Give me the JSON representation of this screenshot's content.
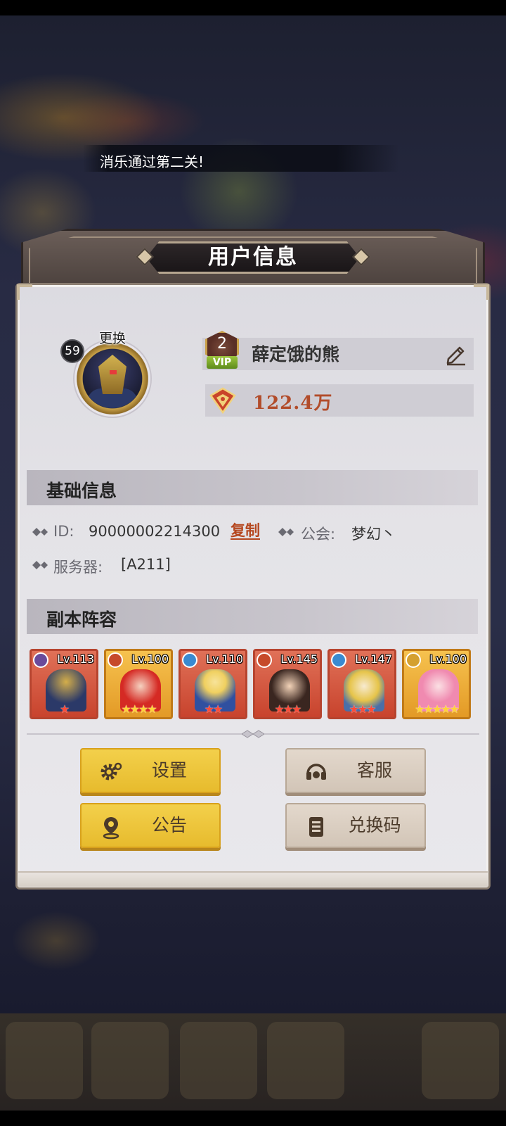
{
  "toast": {
    "message": "消乐通过第二关!"
  },
  "dialog": {
    "title": "用户信息"
  },
  "profile": {
    "level": "59",
    "change_avatar": "更换",
    "vip_level": "2",
    "vip_label": "VIP",
    "name": "薛定饿的熊",
    "power": "122.4万"
  },
  "basic_info": {
    "title": "基础信息",
    "id_label": "ID:",
    "id_value": "90000002214300",
    "copy": "复制",
    "guild_label": "公会:",
    "guild_value": "梦幻丶",
    "server_label": "服务器:",
    "server_value": "[A211]"
  },
  "lineup": {
    "title": "副本阵容",
    "heroes": [
      {
        "level": "Lv.113",
        "stars": "★",
        "rarity": "red",
        "element": "purple",
        "star_count": 1
      },
      {
        "level": "Lv.100",
        "stars": "★★★★",
        "rarity": "gold",
        "element": "red",
        "star_count": 4
      },
      {
        "level": "Lv.110",
        "stars": "★★",
        "rarity": "red",
        "element": "blue",
        "star_count": 2
      },
      {
        "level": "Lv.145",
        "stars": "★★★",
        "rarity": "red",
        "element": "red",
        "star_count": 3
      },
      {
        "level": "Lv.147",
        "stars": "★★★",
        "rarity": "red",
        "element": "blue",
        "star_count": 3
      },
      {
        "level": "Lv.100",
        "stars": "★★★★★",
        "rarity": "gold",
        "element": "gold",
        "star_count": 5
      }
    ]
  },
  "buttons": {
    "settings": "设置",
    "support": "客服",
    "notice": "公告",
    "redeem": "兑换码"
  },
  "colors": {
    "accent_yellow": "#f3d04b",
    "power_text": "#b24c2a",
    "copy_link": "#b5471f",
    "vip_green": "#7fb02f"
  }
}
